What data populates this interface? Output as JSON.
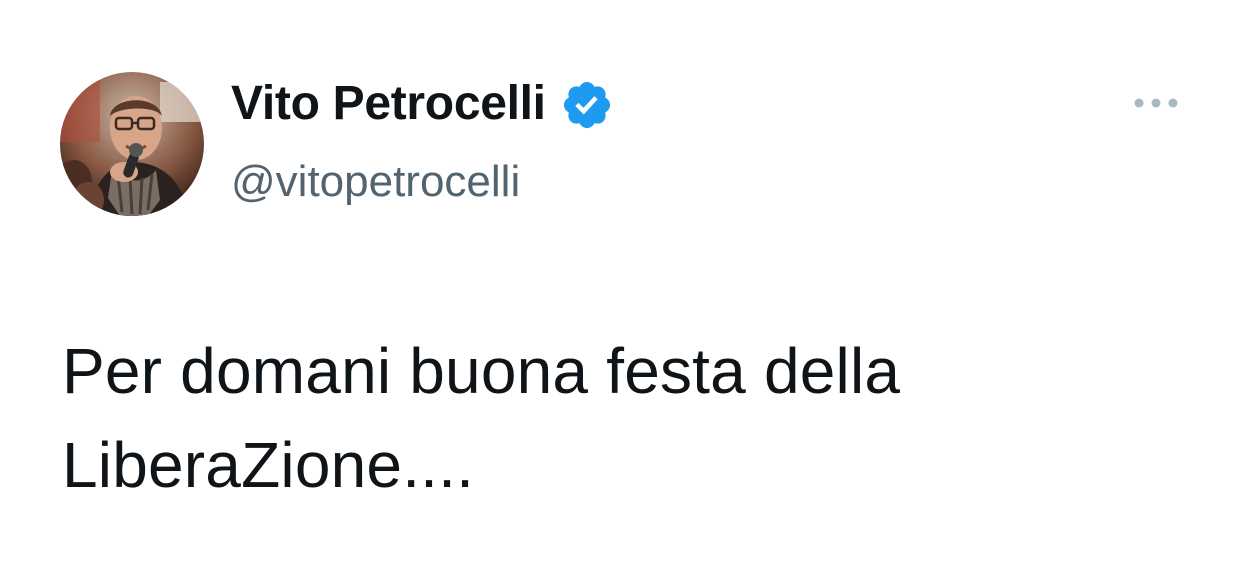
{
  "author": {
    "display_name": "Vito Petrocelli",
    "handle": "@vitopetrocelli",
    "verified": true,
    "avatar_icon": "profile-photo"
  },
  "menu": {
    "icon": "more-options-icon"
  },
  "tweet": {
    "lines": [
      "Per domani buona festa della",
      "LiberaZione...."
    ]
  },
  "colors": {
    "text_primary": "#0f1419",
    "text_secondary": "#536471",
    "verified_blue": "#1d9bf0",
    "more_icon": "#aab8c2"
  }
}
